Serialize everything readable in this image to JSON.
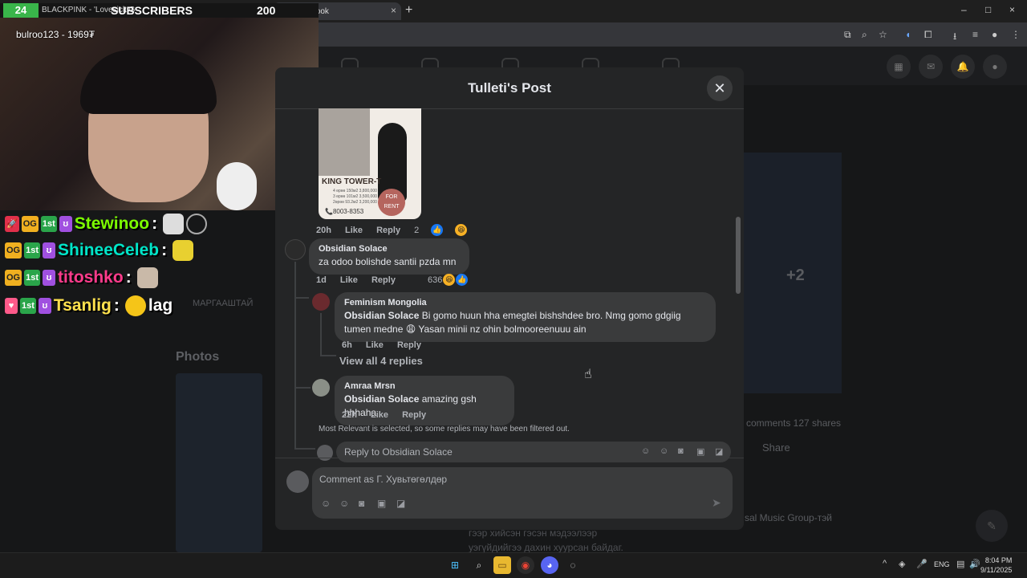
{
  "browser": {
    "tab_title": "Facebook",
    "tab_close": "×",
    "new_tab": "+",
    "window_controls": [
      "–",
      "□",
      "×"
    ]
  },
  "stream": {
    "sub_count": "24",
    "song": "BLACKPINK - 'Lovesick G",
    "sub_label": "SUBSCRIBERS",
    "sub_total": "200",
    "donor": "bulroo123 - 1969₮",
    "chat": [
      {
        "name": "Stewinoo",
        "color": "#7CFC00",
        "msg": ""
      },
      {
        "name": "ShineeCeleb",
        "color": "#00e5c8",
        "msg": ""
      },
      {
        "name": "titoshko",
        "color": "#ff3b8b",
        "msg": ""
      },
      {
        "name": "Tsanlig",
        "color": "#ffe14d",
        "msg": "lag"
      }
    ]
  },
  "background": {
    "photos": "Photos",
    "plus_two": "+2",
    "name_fragment": "МАРГААШТАЙ",
    "shares_text": "comments   127 shares",
    "share": "Share",
    "music": "sal Music Group-тэй",
    "bottom_line1": "гээр хийсэн     гэсэн мэдээлээр",
    "bottom_line2": "уэгүйдийгээ   дахин хуурсан   байдаг."
  },
  "modal": {
    "title": "Tulleti's Post",
    "close": "✕",
    "flyer": {
      "title": "KING TOWER-T",
      "lines": [
        "4 өрөө 150м2 3,800,000",
        "3 өрөө 101м2 3,500,000",
        "2өрөө 93.2м2 3,200,000"
      ],
      "phone": "📞8003-8353",
      "badge_line1": "FOR",
      "badge_line2": "RENT"
    },
    "post_meta": {
      "time": "20h",
      "like": "Like",
      "reply": "Reply",
      "reactions": "2"
    },
    "comments": [
      {
        "name": "Obsidian Solace",
        "text": "za odoo bolishde santii pzda mn",
        "time": "1d",
        "like": "Like",
        "reply": "Reply",
        "reactions": "636"
      },
      {
        "name": "Feminism Mongolia",
        "tag": "Obsidian Solace",
        "text": " Bi gomo huun hha emegtei bishshdee bro. Nmg gomo gdgiig tumen medne 😩 Yasan minii nz ohin bolmooreenuuu ain",
        "time": "6h",
        "like": "Like",
        "reply": "Reply"
      },
      {
        "name": "Amraa Mrsn",
        "tag": "Obsidian Solace",
        "text": " amazing gsh hhhaha",
        "time": "22h",
        "like": "Like",
        "reply": "Reply"
      }
    ],
    "view_all": "View all 4 replies",
    "filter_note": "Most Relevant is selected, so some replies may have been filtered out.",
    "reply_placeholder": "Reply to Obsidian Solace",
    "comment_placeholder": "Comment as Г. Хувьтөгөлдөр"
  },
  "taskbar": {
    "lang": "ENG",
    "time": "8:04 PM",
    "date": "9/11/2025"
  }
}
